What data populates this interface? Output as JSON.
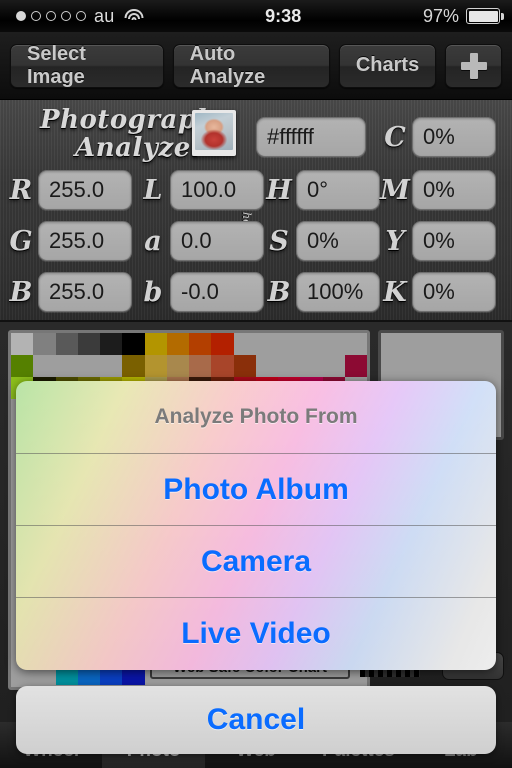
{
  "status_bar": {
    "carrier": "au",
    "signal_dots_filled": 1,
    "signal_dots_total": 5,
    "wifi_icon": "wifi-icon",
    "time": "9:38",
    "battery_percent": "97%"
  },
  "toolbar": {
    "select_image": "Select Image",
    "auto_analyze": "Auto Analyze",
    "charts": "Charts",
    "add": "+"
  },
  "header": {
    "logo_line1": "Photograph",
    "logo_line2": "Analyzer",
    "hex_label": "hex",
    "thumbnail_alt": "photo-thumbnail"
  },
  "fields": {
    "hex": {
      "label": "hex",
      "value": "#ffffff"
    },
    "r": {
      "label": "R",
      "value": "255.0"
    },
    "g": {
      "label": "G",
      "value": "255.0"
    },
    "b_rgb": {
      "label": "B",
      "value": "255.0"
    },
    "l": {
      "label": "L",
      "value": "100.0"
    },
    "a": {
      "label": "a",
      "value": "0.0"
    },
    "b_lab": {
      "label": "b",
      "value": "-0.0"
    },
    "h": {
      "label": "H",
      "value": "0°"
    },
    "s": {
      "label": "S",
      "value": "0%"
    },
    "b_hsb": {
      "label": "B",
      "value": "100%"
    },
    "c": {
      "label": "C",
      "value": "0%"
    },
    "m": {
      "label": "M",
      "value": "0%"
    },
    "y": {
      "label": "Y",
      "value": "0%"
    },
    "k": {
      "label": "K",
      "value": "0%"
    }
  },
  "content": {
    "web_safe_label": "Web Safe Color Chart",
    "chart_rows": [
      [
        "#b3b3b3",
        "#808080",
        "#595959",
        "#3b3b3b",
        "#1c1c1c",
        "#000000",
        "#b39500",
        "#b36b00",
        "#b33f00",
        "#b32000",
        "#9e9e9e",
        "#9e9e9e",
        "#9e9e9e",
        "#9e9e9e",
        "#9e9e9e",
        "#9e9e9e"
      ],
      [
        "#558000",
        "#9e9e9e",
        "#9e9e9e",
        "#9e9e9e",
        "#9e9e9e",
        "#7a6000",
        "#b3942f",
        "#a8884d",
        "#a86a4a",
        "#a8452a",
        "#8a2f0a",
        "#9e9e9e",
        "#9e9e9e",
        "#9e9e9e",
        "#9e9e9e",
        "#8c0a33"
      ],
      [
        "#8cbf1a",
        "#1a1a00",
        "#4d4d00",
        "#6b6b00",
        "#999900",
        "#b3b300",
        "#a89a4d",
        "#a8734d",
        "#3b1a0a",
        "#6b1f0a",
        "#a80a1a",
        "#c2001a",
        "#c2002b",
        "#b3004d",
        "#8c0a33",
        "#9e9e9e"
      ],
      [
        "#9e9e9e",
        "#9e9e9e",
        "#9e9e9e",
        "#9e9e9e",
        "#9e9e9e",
        "#9e9e9e",
        "#9e9e9e",
        "#9e9e9e",
        "#9e9e9e",
        "#9e9e9e",
        "#9e9e9e",
        "#9e9e9e",
        "#9e9e9e",
        "#9e9e9e",
        "#9e9e9e",
        "#9e9e9e"
      ],
      [
        "#9e9e9e",
        "#9e9e9e",
        "#9e9e9e",
        "#9e9e9e",
        "#9e9e9e",
        "#9e9e9e",
        "#9e9e9e",
        "#9e9e9e",
        "#9e9e9e",
        "#9e9e9e",
        "#9e9e9e",
        "#9e9e9e",
        "#9e9e9e",
        "#9e9e9e",
        "#9e9e9e",
        "#9e9e9e"
      ],
      [
        "#9e9e9e",
        "#9e9e9e",
        "#9e9e9e",
        "#9e9e9e",
        "#9e9e9e",
        "#9e9e9e",
        "#9e9e9e",
        "#9e9e9e",
        "#9e9e9e",
        "#9e9e9e",
        "#9e9e9e",
        "#9e9e9e",
        "#9e9e9e",
        "#9e9e9e",
        "#9e9e9e",
        "#9e9e9e"
      ],
      [
        "#9e9e9e",
        "#9e9e9e",
        "#9e9e9e",
        "#9e9e9e",
        "#9e9e9e",
        "#9e9e9e",
        "#9e9e9e",
        "#9e9e9e",
        "#9e9e9e",
        "#9e9e9e",
        "#9e9e9e",
        "#9e9e9e",
        "#9e9e9e",
        "#9e9e9e",
        "#9e9e9e",
        "#9e9e9e"
      ],
      [
        "#9e9e9e",
        "#9e9e9e",
        "#9e9e9e",
        "#9e9e9e",
        "#9e9e9e",
        "#9e9e9e",
        "#9e9e9e",
        "#9e9e9e",
        "#9e9e9e",
        "#9e9e9e",
        "#9e9e9e",
        "#9e9e9e",
        "#9e9e9e",
        "#9e9e9e",
        "#9e9e9e",
        "#9e9e9e"
      ],
      [
        "#9e9e9e",
        "#9e9e9e",
        "#9e9e9e",
        "#9e9e9e",
        "#9e9e9e",
        "#9e9e9e",
        "#9e9e9e",
        "#9e9e9e",
        "#9e9e9e",
        "#9e9e9e",
        "#9e9e9e",
        "#9e9e9e",
        "#9e9e9e",
        "#9e9e9e",
        "#9e9e9e",
        "#9e9e9e"
      ],
      [
        "#9e9e9e",
        "#9e9e9e",
        "#9e9e9e",
        "#9e9e9e",
        "#9e9e9e",
        "#9e9e9e",
        "#9e9e9e",
        "#9e9e9e",
        "#9e9e9e",
        "#9e9e9e",
        "#9e9e9e",
        "#9e9e9e",
        "#9e9e9e",
        "#9e9e9e",
        "#9e9e9e",
        "#9e9e9e"
      ],
      [
        "#9e9e9e",
        "#9e9e9e",
        "#9e9e9e",
        "#9e9e9e",
        "#9e9e9e",
        "#9e9e9e",
        "#9e9e9e",
        "#9e9e9e",
        "#9e9e9e",
        "#9e9e9e",
        "#9e9e9e",
        "#9e9e9e",
        "#9e9e9e",
        "#9e9e9e",
        "#9e9e9e",
        "#9e9e9e"
      ],
      [
        "#9e9e9e",
        "#9e9e9e",
        "#9e9e9e",
        "#9e9e9e",
        "#9e9e9e",
        "#9e9e9e",
        "#9e9e9e",
        "#9e9e9e",
        "#9e9e9e",
        "#9e9e9e",
        "#9e9e9e",
        "#9e9e9e",
        "#9e9e9e",
        "#9e9e9e",
        "#9e9e9e",
        "#9e9e9e"
      ],
      [
        "#9e9e9e",
        "#9e9e9e",
        "#9e9e9e",
        "#9e9e9e",
        "#9e9e9e",
        "#9e9e9e",
        "#9e9e9e",
        "#9e9e9e",
        "#9e9e9e",
        "#9e9e9e",
        "#9e9e9e",
        "#9e9e9e",
        "#9e9e9e",
        "#9e9e9e",
        "#9e9e9e",
        "#9e9e9e"
      ],
      [
        "#9e9e9e",
        "#9e9e9e",
        "#9e9e9e",
        "#9e9e9e",
        "#9e9e9e",
        "#9e9e9e",
        "#9e9e9e",
        "#9e9e9e",
        "#9e9e9e",
        "#9e9e9e",
        "#9e9e9e",
        "#9e9e9e",
        "#9e9e9e",
        "#9e9e9e",
        "#9e9e9e",
        "#9e9e9e"
      ],
      [
        "#9e9e9e",
        "#9e9e9e",
        "#9e9e9e",
        "#9e9e9e",
        "#9e9e9e",
        "#9e9e9e",
        "#9e9e9e",
        "#9e9e9e",
        "#9e9e9e",
        "#9e9e9e",
        "#9e9e9e",
        "#9e9e9e",
        "#9e9e9e",
        "#9e9e9e",
        "#9e9e9e",
        "#9e9e9e"
      ],
      [
        "#9e9e9e",
        "#9e9e9e",
        "#00919e",
        "#0a66c2",
        "#0a3fc2",
        "#0a15a8",
        "#9e9e9e",
        "#9e9e9e",
        "#9e9e9e",
        "#9e9e9e",
        "#9e9e9e",
        "#9e9e9e",
        "#9e9e9e",
        "#9e9e9e",
        "#9e9e9e",
        "#9e9e9e"
      ]
    ]
  },
  "action_sheet": {
    "title": "Analyze Photo From",
    "options": [
      "Photo Album",
      "Camera",
      "Live Video"
    ],
    "cancel": "Cancel",
    "accent_color": "#0a6cff"
  },
  "tab_bar": {
    "tabs": [
      "Wheel",
      "Photo",
      "Web",
      "Palettes",
      "Lab"
    ],
    "selected_index": 1
  }
}
